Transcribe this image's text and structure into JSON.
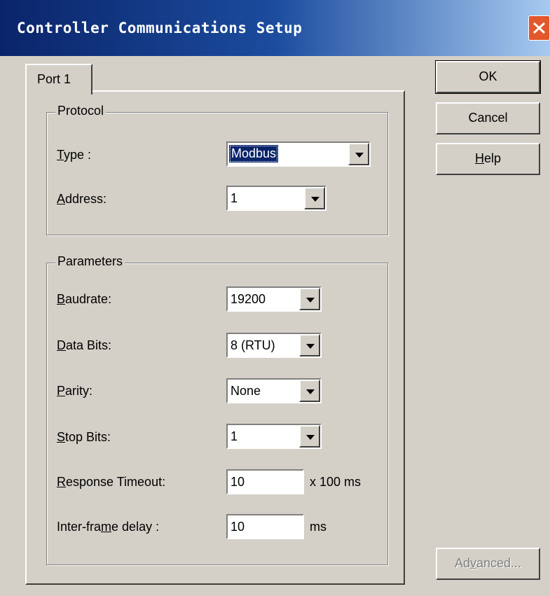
{
  "window": {
    "title": "Controller Communications Setup"
  },
  "tabs": [
    {
      "label": "Port 1"
    }
  ],
  "protocol": {
    "group_label": "Protocol",
    "type": {
      "label_u": "T",
      "label_rest": "ype :",
      "value": "Modbus"
    },
    "address": {
      "label_u": "A",
      "label_rest": "ddress:",
      "value": "1"
    }
  },
  "parameters": {
    "group_label": "Parameters",
    "baudrate": {
      "label_u": "B",
      "label_rest": "audrate:",
      "value": "19200"
    },
    "data_bits": {
      "label_u": "D",
      "label_rest": "ata Bits:",
      "value": "8 (RTU)"
    },
    "parity": {
      "label_u": "P",
      "label_rest": "arity:",
      "value": "None"
    },
    "stop_bits": {
      "label_u": "S",
      "label_rest": "top Bits:",
      "value": "1"
    },
    "response_timeout": {
      "label_u": "R",
      "label_rest": "esponse Timeout:",
      "value": "10",
      "unit": "x 100 ms"
    },
    "inter_frame_delay": {
      "label_pre": "Inter-fra",
      "label_u": "m",
      "label_rest": "e delay :",
      "value": "10",
      "unit": "ms"
    }
  },
  "buttons": {
    "ok": "OK",
    "cancel": "Cancel",
    "help_u": "H",
    "help_rest": "elp",
    "advanced_pre": "Ad",
    "advanced_u": "v",
    "advanced_rest": "anced..."
  },
  "colors": {
    "titlebar": "#0a246a",
    "dialog_bg": "#d4d0c8",
    "selection": "#0a246a",
    "close": "#e2572c"
  }
}
